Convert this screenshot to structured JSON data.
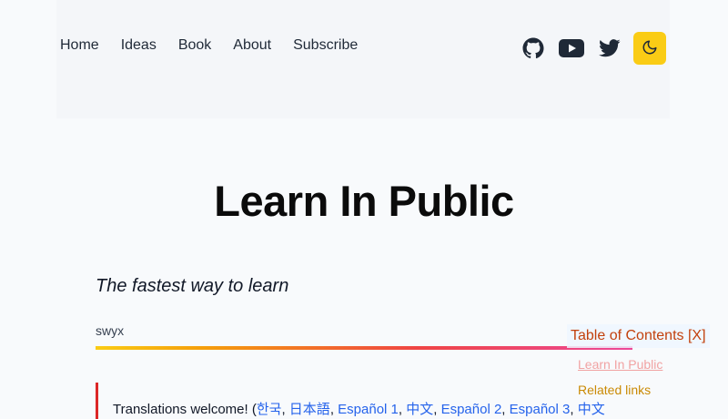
{
  "nav": {
    "items": [
      "Home",
      "Ideas",
      "Book",
      "About",
      "Subscribe"
    ]
  },
  "social": {
    "icons": [
      "github-icon",
      "youtube-icon",
      "twitter-icon"
    ],
    "theme_toggle_icon": "moon-icon"
  },
  "article": {
    "title": "Learn In Public",
    "subtitle": "The fastest way to learn",
    "author": "swyx",
    "translation_prefix": "Translations welcome! (",
    "translations": [
      "한국",
      "日本語",
      "Español 1",
      "中文",
      "Español 2",
      "Español 3",
      "中文"
    ]
  },
  "toc": {
    "header": "Table of Contents [X]",
    "items": [
      "Learn In Public",
      "Related links"
    ]
  },
  "colors": {
    "accent": "#facc15",
    "link": "#2563eb",
    "quote_border": "#dc2626",
    "toc_header": "#c2410c"
  }
}
